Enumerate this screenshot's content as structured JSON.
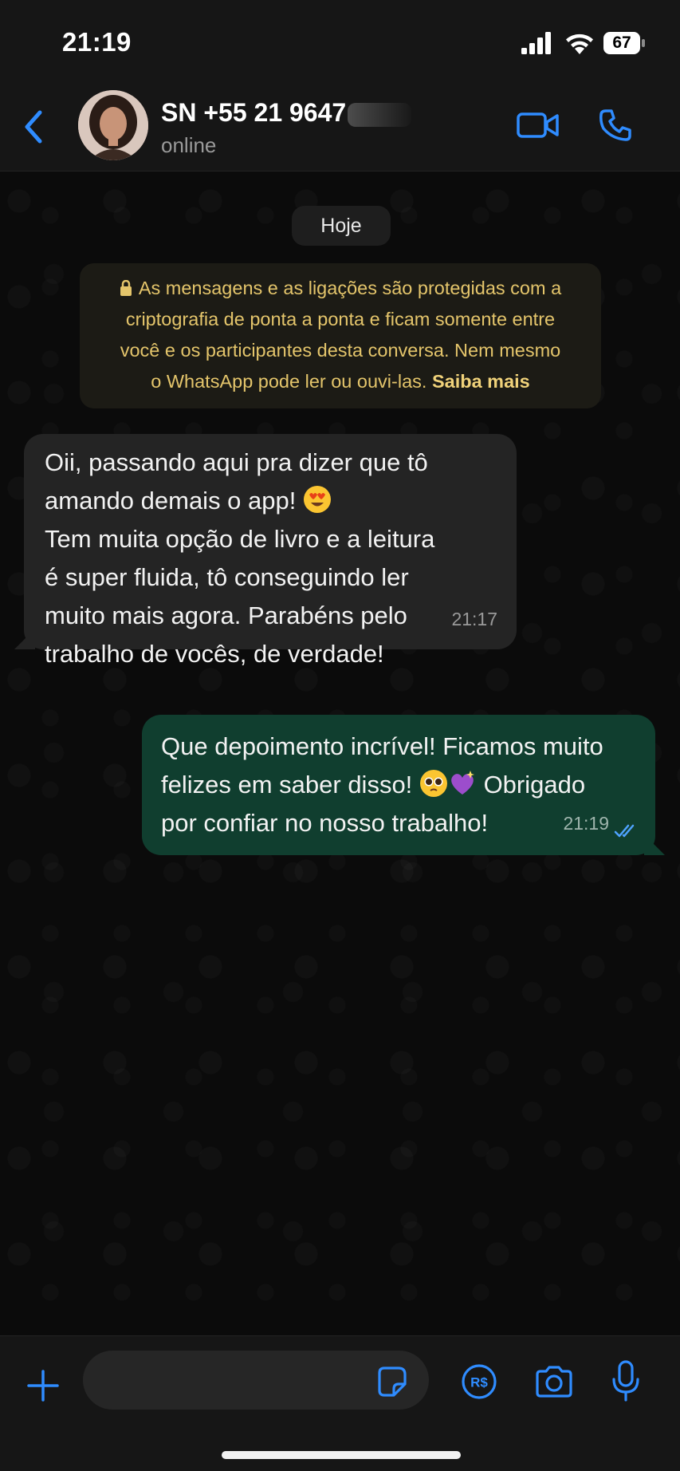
{
  "status_bar": {
    "time": "21:19",
    "battery_level": "67"
  },
  "header": {
    "contact_name": "SN +55 21 9647",
    "status": "online"
  },
  "chat": {
    "date_chip": "Hoje",
    "encryption_notice": {
      "lines": [
        "As mensagens e as ligações são protegidas com a",
        "criptografia de ponta a ponta e ficam somente entre",
        "você e os participantes desta conversa. Nem mesmo",
        "o WhatsApp pode ler ou ouvi-las."
      ],
      "link": "Saiba mais"
    },
    "messages": [
      {
        "direction": "incoming",
        "lines": [
          "Oii, passando aqui pra dizer que tô",
          "amando demais o app!",
          "Tem muita opção de livro e a leitura",
          "é super fluida, tô conseguindo ler",
          "muito mais agora. Parabéns pelo",
          "trabalho de vocês, de verdade!"
        ],
        "emoji": "heart-eyes-emoji",
        "time": "21:17"
      },
      {
        "direction": "outgoing",
        "lines": [
          "Que depoimento incrível! Ficamos muito",
          "felizes em saber disso!",
          "Obrigado",
          "por confiar no nosso trabalho!"
        ],
        "emojis": [
          "pleading-face-emoji",
          "sparkling-heart-emoji"
        ],
        "time": "21:19",
        "status_icon": "double-check-read-icon"
      }
    ]
  },
  "input_bar": {
    "placeholder": "",
    "icons": [
      "plus-icon",
      "sticker-icon",
      "payment-icon",
      "camera-icon",
      "microphone-icon"
    ]
  },
  "colors": {
    "accent": "#2f8cff",
    "incoming_bubble": "#242424",
    "outgoing_bubble": "#103e2f",
    "notice_text": "#e4c56b"
  }
}
